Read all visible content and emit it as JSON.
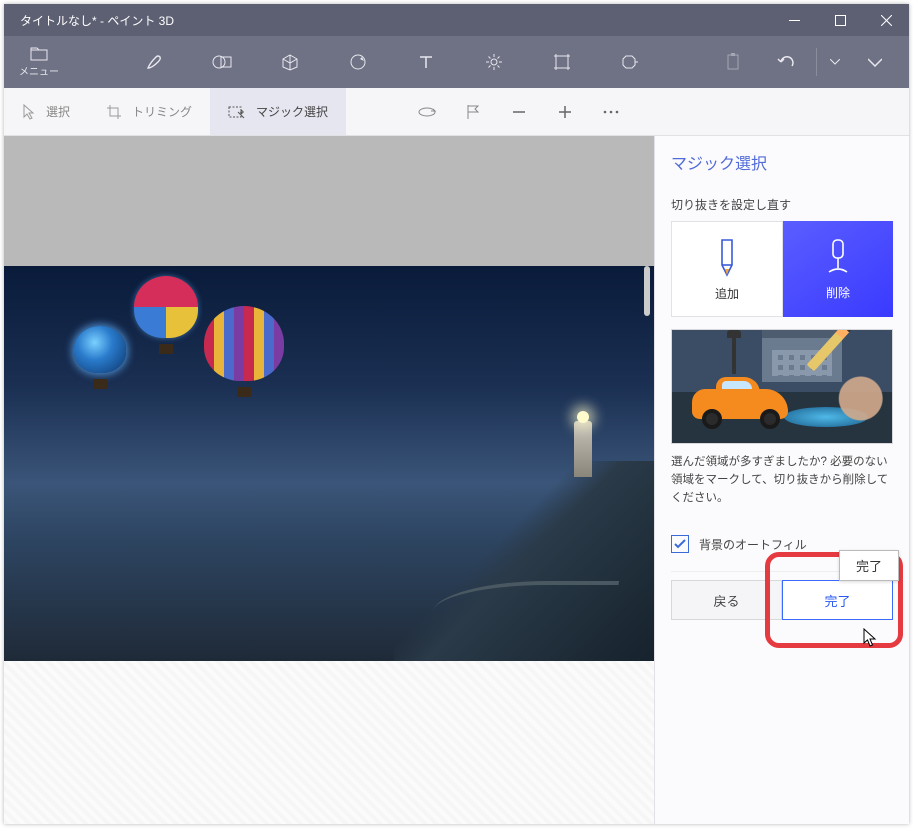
{
  "titlebar": {
    "title": "タイトルなし* - ペイント 3D"
  },
  "ribbon": {
    "menu_label": "メニュー"
  },
  "sectoolbar": {
    "select": "選択",
    "trim": "トリミング",
    "magic": "マジック選択"
  },
  "sidebar": {
    "title": "マジック選択",
    "section_label": "切り抜きを設定し直す",
    "add_label": "追加",
    "remove_label": "削除",
    "help_text": "選んだ領域が多すぎましたか? 必要のない領域をマークして、切り抜きから削除してください。",
    "autofill_label": "背景のオートフィル",
    "back_btn": "戻る",
    "done_btn": "完了",
    "tooltip": "完了"
  }
}
